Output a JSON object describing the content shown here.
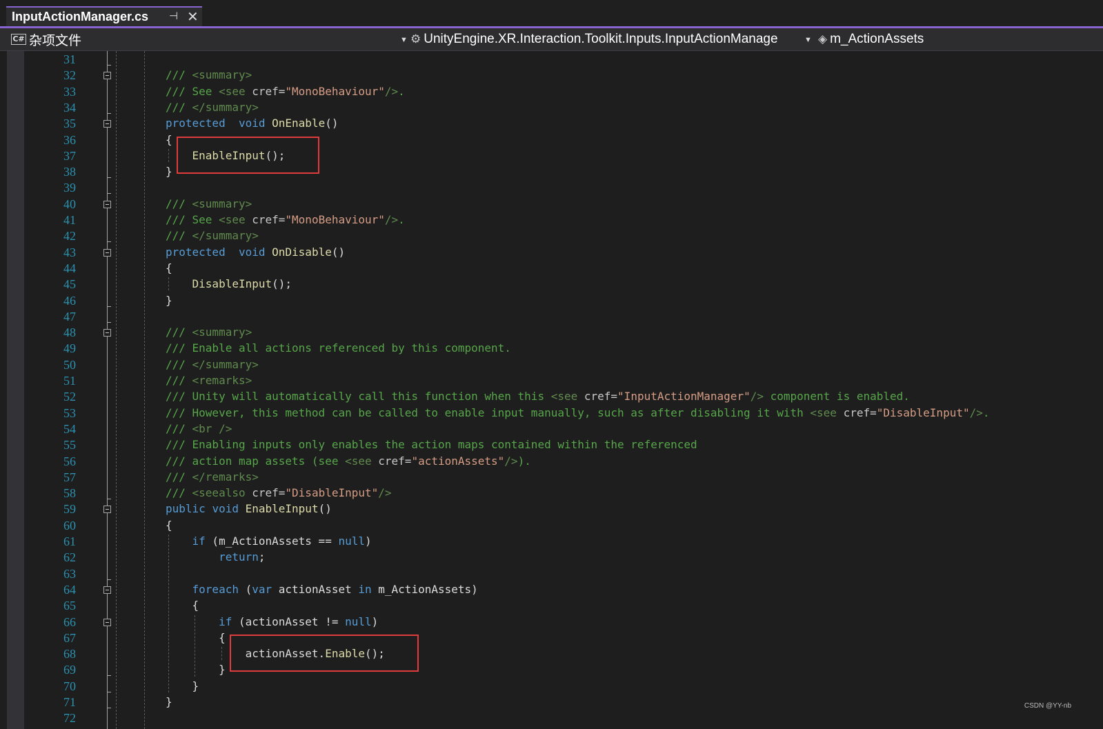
{
  "tab": {
    "title": "InputActionManager.cs",
    "pin": "⊣",
    "close": "✕"
  },
  "navbar": {
    "project": "杂项文件",
    "type": "UnityEngine.XR.Interaction.Toolkit.Inputs.InputActionManage",
    "member": "m_ActionAssets"
  },
  "colors": {
    "accent": "#8a63d2",
    "line_number": "#2b91af",
    "comment": "#57a64a",
    "keyword": "#569cd6",
    "method": "#dcdcaa",
    "highlight_box": "#e03c3c"
  },
  "lines": [
    {
      "n": "31",
      "segs": []
    },
    {
      "n": "32",
      "segs": [
        [
          "cmt",
          "/// "
        ],
        [
          "xml",
          "<summary>"
        ]
      ]
    },
    {
      "n": "33",
      "segs": [
        [
          "cmt",
          "/// See "
        ],
        [
          "xml",
          "<see "
        ],
        [
          "attr",
          "cref="
        ],
        [
          "str",
          "\"MonoBehaviour\""
        ],
        [
          "xml",
          "/>"
        ],
        [
          "cmt",
          "."
        ]
      ]
    },
    {
      "n": "34",
      "segs": [
        [
          "cmt",
          "/// "
        ],
        [
          "xml",
          "</summary>"
        ]
      ]
    },
    {
      "n": "35",
      "segs": [
        [
          "kw",
          "protected"
        ],
        [
          "",
          "  "
        ],
        [
          "kw",
          "void"
        ],
        [
          "",
          " "
        ],
        [
          "fn",
          "OnEnable"
        ],
        [
          "",
          "()"
        ]
      ]
    },
    {
      "n": "36",
      "segs": [
        [
          "",
          "{"
        ]
      ]
    },
    {
      "n": "37",
      "segs": [
        [
          "",
          "    "
        ],
        [
          "fn",
          "EnableInput"
        ],
        [
          "",
          "();"
        ]
      ]
    },
    {
      "n": "38",
      "segs": [
        [
          "",
          "}"
        ]
      ]
    },
    {
      "n": "39",
      "segs": []
    },
    {
      "n": "40",
      "segs": [
        [
          "cmt",
          "/// "
        ],
        [
          "xml",
          "<summary>"
        ]
      ]
    },
    {
      "n": "41",
      "segs": [
        [
          "cmt",
          "/// See "
        ],
        [
          "xml",
          "<see "
        ],
        [
          "attr",
          "cref="
        ],
        [
          "str",
          "\"MonoBehaviour\""
        ],
        [
          "xml",
          "/>"
        ],
        [
          "cmt",
          "."
        ]
      ]
    },
    {
      "n": "42",
      "segs": [
        [
          "cmt",
          "/// "
        ],
        [
          "xml",
          "</summary>"
        ]
      ]
    },
    {
      "n": "43",
      "segs": [
        [
          "kw",
          "protected"
        ],
        [
          "",
          "  "
        ],
        [
          "kw",
          "void"
        ],
        [
          "",
          " "
        ],
        [
          "fn",
          "OnDisable"
        ],
        [
          "",
          "()"
        ]
      ]
    },
    {
      "n": "44",
      "segs": [
        [
          "",
          "{"
        ]
      ]
    },
    {
      "n": "45",
      "segs": [
        [
          "",
          "    "
        ],
        [
          "fn",
          "DisableInput"
        ],
        [
          "",
          "();"
        ]
      ]
    },
    {
      "n": "46",
      "segs": [
        [
          "",
          "}"
        ]
      ]
    },
    {
      "n": "47",
      "segs": []
    },
    {
      "n": "48",
      "segs": [
        [
          "cmt",
          "/// "
        ],
        [
          "xml",
          "<summary>"
        ]
      ]
    },
    {
      "n": "49",
      "segs": [
        [
          "cmt",
          "/// Enable all actions referenced by this component."
        ]
      ]
    },
    {
      "n": "50",
      "segs": [
        [
          "cmt",
          "/// "
        ],
        [
          "xml",
          "</summary>"
        ]
      ]
    },
    {
      "n": "51",
      "segs": [
        [
          "cmt",
          "/// "
        ],
        [
          "xml",
          "<remarks>"
        ]
      ]
    },
    {
      "n": "52",
      "segs": [
        [
          "cmt",
          "/// Unity will automatically call this function when this "
        ],
        [
          "xml",
          "<see "
        ],
        [
          "attr",
          "cref="
        ],
        [
          "str",
          "\"InputActionManager\""
        ],
        [
          "xml",
          "/>"
        ],
        [
          "cmt",
          " component is enabled."
        ]
      ]
    },
    {
      "n": "53",
      "segs": [
        [
          "cmt",
          "/// However, this method can be called to enable input manually, such as after disabling it with "
        ],
        [
          "xml",
          "<see "
        ],
        [
          "attr",
          "cref="
        ],
        [
          "str",
          "\"DisableInput\""
        ],
        [
          "xml",
          "/>"
        ],
        [
          "cmt",
          "."
        ]
      ]
    },
    {
      "n": "54",
      "segs": [
        [
          "cmt",
          "/// "
        ],
        [
          "xml",
          "<br />"
        ]
      ]
    },
    {
      "n": "55",
      "segs": [
        [
          "cmt",
          "/// Enabling inputs only enables the action maps contained within the referenced"
        ]
      ]
    },
    {
      "n": "56",
      "segs": [
        [
          "cmt",
          "/// action map assets (see "
        ],
        [
          "xml",
          "<see "
        ],
        [
          "attr",
          "cref="
        ],
        [
          "str",
          "\"actionAssets\""
        ],
        [
          "xml",
          "/>"
        ],
        [
          "cmt",
          ")."
        ]
      ]
    },
    {
      "n": "57",
      "segs": [
        [
          "cmt",
          "/// "
        ],
        [
          "xml",
          "</remarks>"
        ]
      ]
    },
    {
      "n": "58",
      "segs": [
        [
          "cmt",
          "/// "
        ],
        [
          "xml",
          "<seealso "
        ],
        [
          "attr",
          "cref="
        ],
        [
          "str",
          "\"DisableInput\""
        ],
        [
          "xml",
          "/>"
        ]
      ]
    },
    {
      "n": "59",
      "segs": [
        [
          "kw",
          "public"
        ],
        [
          "",
          " "
        ],
        [
          "kw",
          "void"
        ],
        [
          "",
          " "
        ],
        [
          "fn",
          "EnableInput"
        ],
        [
          "",
          "()"
        ]
      ]
    },
    {
      "n": "60",
      "segs": [
        [
          "",
          "{"
        ]
      ]
    },
    {
      "n": "61",
      "segs": [
        [
          "",
          "    "
        ],
        [
          "kw",
          "if"
        ],
        [
          "",
          " (m_ActionAssets == "
        ],
        [
          "kw",
          "null"
        ],
        [
          "",
          ")"
        ]
      ]
    },
    {
      "n": "62",
      "segs": [
        [
          "",
          "        "
        ],
        [
          "kw",
          "return"
        ],
        [
          "",
          ";"
        ]
      ]
    },
    {
      "n": "63",
      "segs": []
    },
    {
      "n": "64",
      "segs": [
        [
          "",
          "    "
        ],
        [
          "kw",
          "foreach"
        ],
        [
          "",
          " ("
        ],
        [
          "kw",
          "var"
        ],
        [
          "",
          " actionAsset "
        ],
        [
          "kw",
          "in"
        ],
        [
          "",
          " m_ActionAssets)"
        ]
      ]
    },
    {
      "n": "65",
      "segs": [
        [
          "",
          "    {"
        ]
      ]
    },
    {
      "n": "66",
      "segs": [
        [
          "",
          "        "
        ],
        [
          "kw",
          "if"
        ],
        [
          "",
          " (actionAsset != "
        ],
        [
          "kw",
          "null"
        ],
        [
          "",
          ")"
        ]
      ]
    },
    {
      "n": "67",
      "segs": [
        [
          "",
          "        {"
        ]
      ]
    },
    {
      "n": "68",
      "segs": [
        [
          "",
          "            actionAsset."
        ],
        [
          "fn",
          "Enable"
        ],
        [
          "",
          "();"
        ]
      ]
    },
    {
      "n": "69",
      "segs": [
        [
          "",
          "        }"
        ]
      ]
    },
    {
      "n": "70",
      "segs": [
        [
          "",
          "    }"
        ]
      ]
    },
    {
      "n": "71",
      "segs": [
        [
          "",
          "}"
        ]
      ]
    },
    {
      "n": "72",
      "segs": []
    }
  ],
  "folds": [
    "32",
    "35",
    "40",
    "43",
    "48",
    "59",
    "64",
    "66"
  ],
  "watermark": "CSDN @YY-nb"
}
